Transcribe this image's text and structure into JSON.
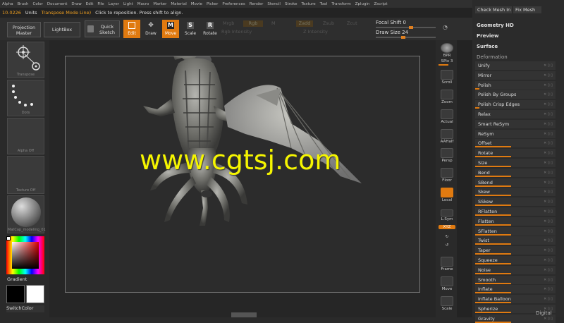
{
  "menu": [
    "Alpha",
    "Brush",
    "Color",
    "Document",
    "Draw",
    "Edit",
    "File",
    "Layer",
    "Light",
    "Macro",
    "Marker",
    "Material",
    "Movie",
    "Picker",
    "Preferences",
    "Render",
    "Stencil",
    "Stroke",
    "Texture",
    "Tool",
    "Transform",
    "Zplugin",
    "Zscript"
  ],
  "status": {
    "value": "10.0226",
    "units": "Units",
    "mode": "Transpose Mode Line)",
    "hint": "Click to reposition. Press shift to align."
  },
  "toolbar": {
    "projection_master": "Projection\nMaster",
    "lightbox": "LightBox",
    "quick_sketch": "Quick\nSketch",
    "edit": "Edit",
    "draw": "Draw",
    "move": "Move",
    "scale": "Scale",
    "rotate": "Rotate",
    "mrgb": "Mrgb",
    "rgb": "Rgb",
    "m": "M",
    "zadd": "Zadd",
    "zsub": "Zsub",
    "zcut": "Zcut",
    "rgb_intensity": "Rgb Intensity",
    "z_intensity": "Z Intensity",
    "focal_shift_label": "Focal Shift",
    "focal_shift_value": "0",
    "draw_size_label": "Draw Size",
    "draw_size_value": "24"
  },
  "left_shelf": {
    "transpose": "Transpose",
    "dots": "Dots",
    "alpha": "Alpha Off",
    "texture": "Texture Off",
    "material": "MatCap_modeling_01",
    "gradient": "Gradient",
    "switchcolor": "SwitchColor"
  },
  "right_shelf": {
    "bpr": "BPR",
    "spix_label": "SPix",
    "spix_value": "3",
    "scroll": "Scroll",
    "zoom": "Zoom",
    "actual": "Actual",
    "aahalf": "AAHalf",
    "persp": "Persp",
    "floor": "Floor",
    "local": "Local",
    "lsym": "L.Sym",
    "xyz": "XYZ",
    "frame": "Frame",
    "move": "Move",
    "scale": "Scale"
  },
  "top_right": {
    "check_mesh": "Check Mesh In",
    "fix_mesh": "Fix Mesh",
    "geometry_hd": "Geometry HD",
    "preview": "Preview",
    "surface": "Surface",
    "deformation": "Deformation"
  },
  "deformation_items": [
    {
      "label": "Unify"
    },
    {
      "label": "Mirror"
    },
    {
      "label": "Polish"
    },
    {
      "label": "Polish By Groups"
    },
    {
      "label": "Polish Crisp Edges"
    },
    {
      "label": "Relax"
    },
    {
      "label": "Smart ReSym"
    },
    {
      "label": "ReSym"
    },
    {
      "label": "Offset"
    },
    {
      "label": "Rotate"
    },
    {
      "label": "Size"
    },
    {
      "label": "Bend"
    },
    {
      "label": "SBend"
    },
    {
      "label": "Skew"
    },
    {
      "label": "SSkew"
    },
    {
      "label": "RFlatten"
    },
    {
      "label": "Flatten"
    },
    {
      "label": "SFlatten"
    },
    {
      "label": "Twist"
    },
    {
      "label": "Taper"
    },
    {
      "label": "Squeeze"
    },
    {
      "label": "Noise"
    },
    {
      "label": "Smooth"
    },
    {
      "label": "Inflate"
    },
    {
      "label": "Inflate Balloon"
    },
    {
      "label": "Spherize"
    },
    {
      "label": "Gravity"
    }
  ],
  "watermark": "www.cgtsj.com",
  "corner_tag": "Digital",
  "colors": {
    "accent": "#e07a10",
    "watermark": "#f5f500"
  }
}
